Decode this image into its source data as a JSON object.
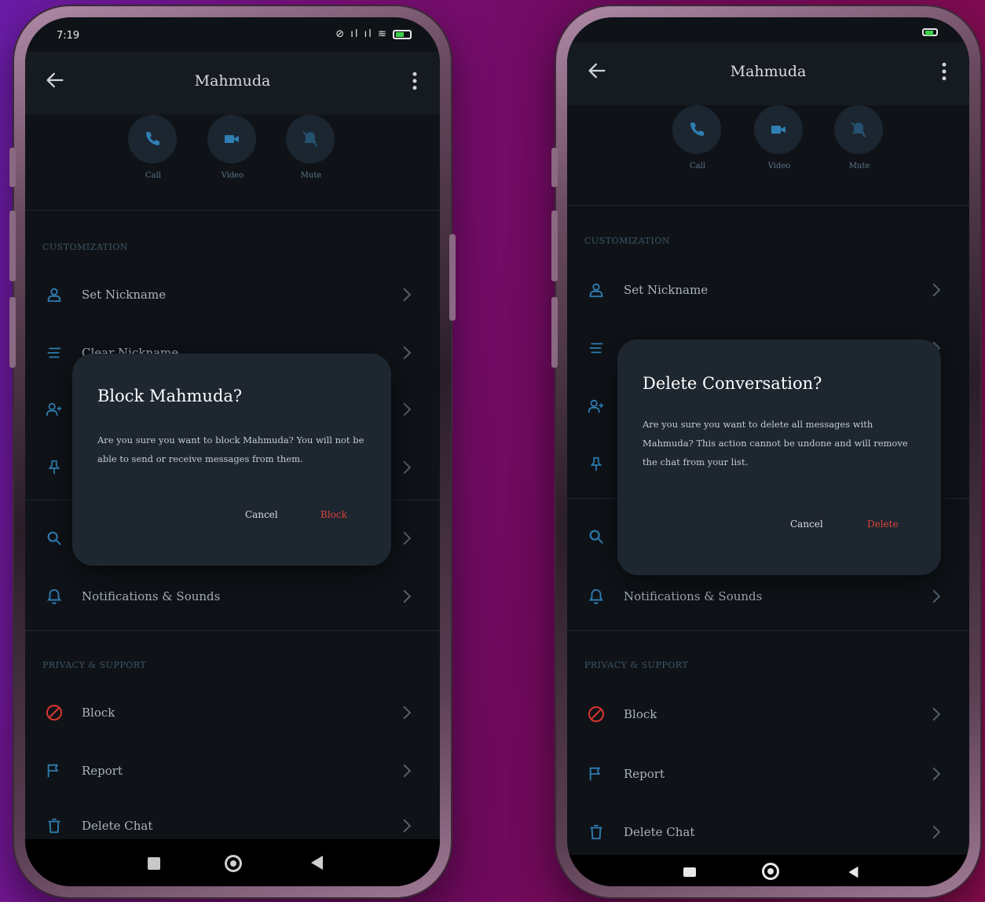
{
  "left_phone": {
    "status": {
      "time": "7:19",
      "icons": "⊘ ıl ıl ≋"
    },
    "header": {
      "title": "Mahmuda"
    },
    "actions": [
      {
        "label": "Call",
        "icon": "phone-icon"
      },
      {
        "label": "Video",
        "icon": "video-icon"
      },
      {
        "label": "Mute",
        "icon": "bell-off-icon"
      }
    ],
    "sections": {
      "customization": "CUSTOMIZATION",
      "privacy": "PRIVACY & SUPPORT"
    },
    "rows": {
      "set_nickname": "Set Nickname",
      "clear_nickname": "Clear Nickname",
      "notifications": "Notifications & Sounds",
      "block": "Block",
      "report": "Report",
      "delete_chat": "Delete Chat"
    },
    "dialog": {
      "title": "Block Mahmuda?",
      "message": "Are you sure you want to block Mahmuda? You will not be able to send or receive messages from them.",
      "cancel": "Cancel",
      "confirm": "Block"
    }
  },
  "right_phone": {
    "header": {
      "title": "Mahmuda"
    },
    "actions": [
      {
        "label": "Call",
        "icon": "phone-icon"
      },
      {
        "label": "Video",
        "icon": "video-icon"
      },
      {
        "label": "Mute",
        "icon": "bell-off-icon"
      }
    ],
    "sections": {
      "customization": "CUSTOMIZATION",
      "privacy": "PRIVACY & SUPPORT"
    },
    "rows": {
      "set_nickname": "Set Nickname",
      "notifications": "Notifications & Sounds",
      "block": "Block",
      "report": "Report",
      "delete_chat": "Delete Chat"
    },
    "dialog": {
      "title": "Delete Conversation?",
      "message": "Are you sure you want to delete all messages with Mahmuda? This action cannot be undone and will remove the chat from your list.",
      "cancel": "Cancel",
      "confirm": "Delete"
    }
  },
  "colors": {
    "accent": "#2f7fb3",
    "danger": "#d9382f",
    "screen_bg": "#0f1318",
    "dialog_bg": "#1e2630"
  }
}
